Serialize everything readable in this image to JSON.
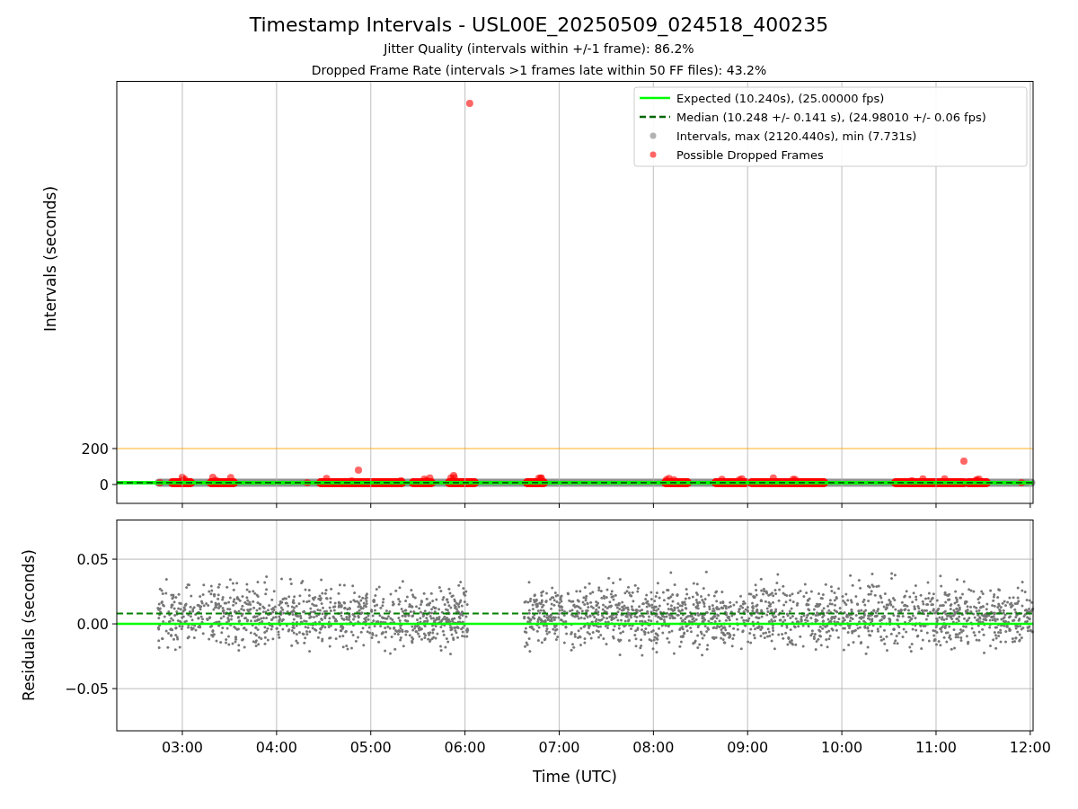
{
  "figure": {
    "title": "Timestamp Intervals - USL00E_20250509_024518_400235",
    "subtitles": [
      "Jitter Quality (intervals within +/-1 frame): 86.2%",
      "Dropped Frame Rate (intervals >1 frames late within 50 FF files): 43.2%"
    ]
  },
  "intervals_chart": {
    "chart_data": {
      "type": "scatter",
      "ylabel": "Intervals (seconds)",
      "x": [
        2.304,
        6.05,
        12.03
      ],
      "xlim": [
        2.304,
        12.03
      ],
      "ylim": [
        -105,
        2245
      ],
      "grid": true,
      "yticks": [
        {
          "value": 0,
          "label": "0"
        },
        {
          "value": 200,
          "label": "200"
        }
      ],
      "series": [
        {
          "name": "Expected (10.240s), (25.00000 fps)",
          "type": "line",
          "color": "#00ff00",
          "line_style": "solid",
          "values": [
            10,
            10,
            10
          ]
        },
        {
          "name": "Median (10.248 +/- 0.141 s), (24.98010 +/- 0.06 fps)",
          "type": "line",
          "color": "#006400",
          "line_style": "dashed",
          "values": [
            10,
            10,
            10
          ]
        },
        {
          "name": "Intervals, max (2120.440s), min (7.731s)",
          "color": "#808080",
          "values": [
            null,
            null,
            null
          ]
        },
        {
          "name": "Possible Dropped Frames",
          "color": "#ff0000",
          "values": [
            null,
            2120,
            null
          ]
        }
      ],
      "ref_lines": [
        {
          "axis": "y",
          "value": 200,
          "color": "#ffa500"
        }
      ],
      "legend": "upper right"
    }
  },
  "residuals_chart": {
    "chart_data": {
      "type": "line",
      "xlabel": "Time (UTC)",
      "ylabel": "Residuals (seconds)",
      "x": [
        2.304,
        12.03
      ],
      "xlim": [
        2.304,
        12.03
      ],
      "ylim": [
        -0.0826,
        0.0806
      ],
      "grid": true,
      "xticks": [
        {
          "value": 3,
          "label": "03:00"
        },
        {
          "value": 4,
          "label": "04:00"
        },
        {
          "value": 5,
          "label": "05:00"
        },
        {
          "value": 6,
          "label": "06:00"
        },
        {
          "value": 7,
          "label": "07:00"
        },
        {
          "value": 8,
          "label": "08:00"
        },
        {
          "value": 9,
          "label": "09:00"
        },
        {
          "value": 10,
          "label": "10:00"
        },
        {
          "value": 11,
          "label": "11:00"
        },
        {
          "value": 12,
          "label": "12:00"
        }
      ],
      "yticks": [
        {
          "value": -0.05,
          "label": "−0.05"
        },
        {
          "value": 0,
          "label": "0.00"
        },
        {
          "value": 0.05,
          "label": "0.05"
        }
      ],
      "series": [
        {
          "color": "#00ff00",
          "line_style": "solid",
          "values": [
            0,
            0
          ]
        },
        {
          "color": "#008000",
          "line_style": "dashed",
          "values": [
            0.008,
            0.008
          ]
        }
      ]
    }
  }
}
